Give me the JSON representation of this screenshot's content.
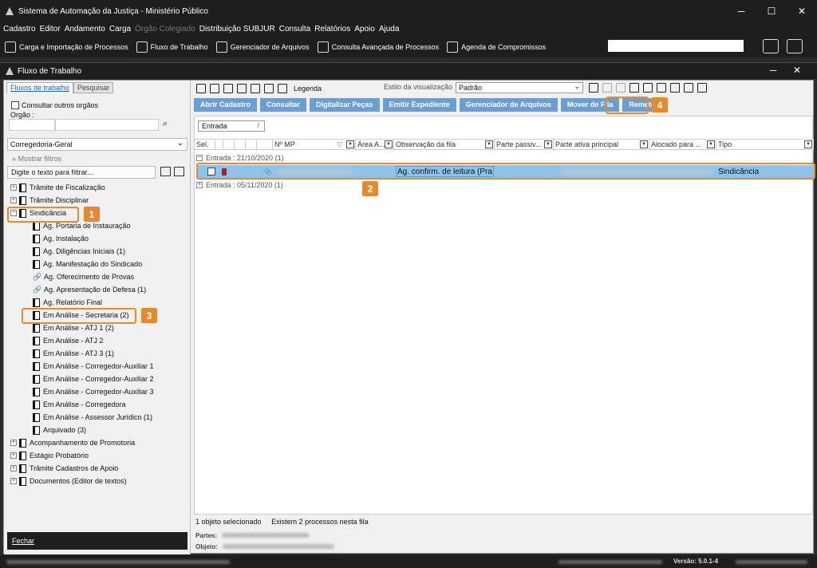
{
  "window": {
    "title": "Sistema de Automação da Justiça - Ministério Público",
    "controls": [
      "─",
      "☐",
      "✕"
    ]
  },
  "menu": [
    "Cadastro",
    "Editor",
    "Andamento",
    "Carga",
    "Órgão Colegiado",
    "Distribuição SUBJUR",
    "Consulta",
    "Relatórios",
    "Apoio",
    "Ajuda"
  ],
  "toolbar": {
    "items": [
      "Carga e Importação de Processos",
      "Fluxo de Trabalho",
      "Gerenciador de Arquivos",
      "Consulta Avançada de Processos",
      "Agenda de Compromissos"
    ]
  },
  "subwindow": {
    "title": "Fluxo de Trabalho"
  },
  "left": {
    "tabs": [
      "Fluxos de trabalho",
      "Pesquisar"
    ],
    "consultar_outros": "Consultar outros orgãos",
    "orgao_label": "Orgão :",
    "select_value": "Corregedoria-Geral",
    "mostrar_filtros": "Mostrar filtros",
    "filter_placeholder": "Digite o texto para filtrar...",
    "tree": [
      {
        "label": "Trâmite de Fiscalização",
        "level": 0,
        "exp": "+"
      },
      {
        "label": "Trâmite Disciplinar",
        "level": 0,
        "exp": "+"
      },
      {
        "label": "Sindicância",
        "level": 0,
        "exp": "−"
      },
      {
        "label": "Ag. Portaria de Instauração",
        "level": 1
      },
      {
        "label": "Ag. Instalação",
        "level": 1
      },
      {
        "label": "Ag. Diligências Iniciais (1)",
        "level": 1
      },
      {
        "label": "Ag. Manifestação do Sindicado",
        "level": 1
      },
      {
        "label": "Ag. Oferecimento de Provas",
        "level": 1,
        "link": true
      },
      {
        "label": "Ag. Apresentação de Defesa (1)",
        "level": 1,
        "link": true
      },
      {
        "label": "Ag. Relatório Final",
        "level": 1
      },
      {
        "label": "Em Análise - Secretaria (2)",
        "level": 1
      },
      {
        "label": "Em Análise - ATJ 1 (2)",
        "level": 1
      },
      {
        "label": "Em Análise - ATJ 2",
        "level": 1
      },
      {
        "label": "Em Análise - ATJ 3 (1)",
        "level": 1
      },
      {
        "label": "Em Análise - Corregedor-Auxiliar 1",
        "level": 1
      },
      {
        "label": "Em Análise - Corregedor-Auxiliar 2",
        "level": 1
      },
      {
        "label": "Em Análise - Corregedor-Auxiliar 3",
        "level": 1
      },
      {
        "label": "Em Análise - Corregedora",
        "level": 1
      },
      {
        "label": "Em Análise - Assessor Jurídico (1)",
        "level": 1
      },
      {
        "label": "Arquivado (3)",
        "level": 1
      },
      {
        "label": "Acompanhamento de Promotoria",
        "level": 0,
        "exp": "+"
      },
      {
        "label": "Estágio Probatório",
        "level": 0,
        "exp": "+"
      },
      {
        "label": "Trâmite Cadastros de Apoio",
        "level": 0,
        "exp": "+"
      },
      {
        "label": "Documentos (Editor de textos)",
        "level": 0,
        "exp": "+"
      }
    ],
    "fechar": "Fechar"
  },
  "right": {
    "legenda": "Legenda",
    "estilo_label": "Estilo da visualização",
    "estilo_value": "Padrão",
    "actions": [
      "Abrir Cadastro",
      "Consultar",
      "Digitalizar Peças",
      "Emitir Expediente",
      "Gerenciador de Arquivos",
      "Mover de Fila",
      "Remeter"
    ],
    "group_by": "Entrada",
    "columns": [
      "Sel.",
      "Nº MP",
      "Área A...",
      "Observação da fila",
      "Parte passiv...",
      "Parte ativa principal",
      "Alocado para ...",
      "Tipo"
    ],
    "groups": [
      "Entrada : 21/10/2020  (1)",
      "Entrada : 05/11/2020  (1)"
    ],
    "row": {
      "observacao": "Ag. confirm. de leitura (Pra",
      "tipo": "Sindicância"
    },
    "status": [
      "1 objeto selecionado",
      "Existem 2 processos nesta fila"
    ],
    "partes_label": "Partes:",
    "objeto_label": "Objeto:"
  },
  "annotations": [
    "1",
    "2",
    "3",
    "4"
  ],
  "bottom": {
    "versao": "Versão: 5.0.1-4"
  },
  "colors": {
    "highlight": "#e68a2e",
    "action_button": "#6a9fd4",
    "selected_row": "#8cc4ee",
    "dark_chrome": "#1e1e1e"
  }
}
